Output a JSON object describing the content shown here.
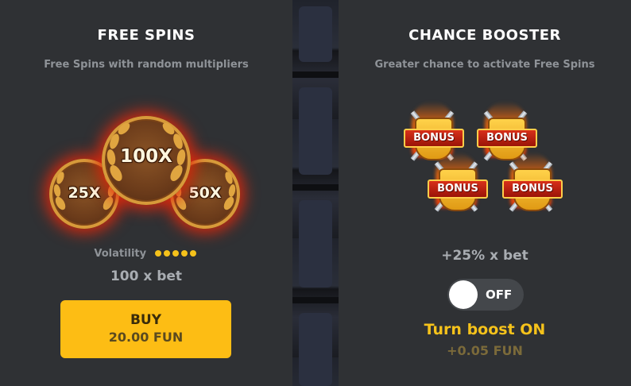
{
  "free_spins": {
    "title": "FREE SPINS",
    "subtitle": "Free Spins with random multipliers",
    "multipliers": [
      "25X",
      "100X",
      "50X"
    ],
    "volatility_label": "Volatility",
    "volatility_level": 5,
    "volatility_max": 5,
    "price": "100 x bet",
    "buy_label": "BUY",
    "buy_price": "20.00 FUN"
  },
  "chance_booster": {
    "title": "CHANCE BOOSTER",
    "subtitle": "Greater chance to activate Free Spins",
    "bonus_labels": [
      "BONUS",
      "BONUS",
      "BONUS",
      "BONUS"
    ],
    "boost_text": "+25% x bet",
    "toggle_state": "OFF",
    "toggle_on": false,
    "turn_boost_label": "Turn boost ON",
    "boost_cost": "+0.05 FUN"
  },
  "colors": {
    "panel": "#2f3134",
    "accent": "#fdbd14",
    "dot": "#f5c21b",
    "glow": "#e6280a"
  },
  "icons": [
    "laurel-medallion-icon",
    "bonus-swords-icon"
  ]
}
